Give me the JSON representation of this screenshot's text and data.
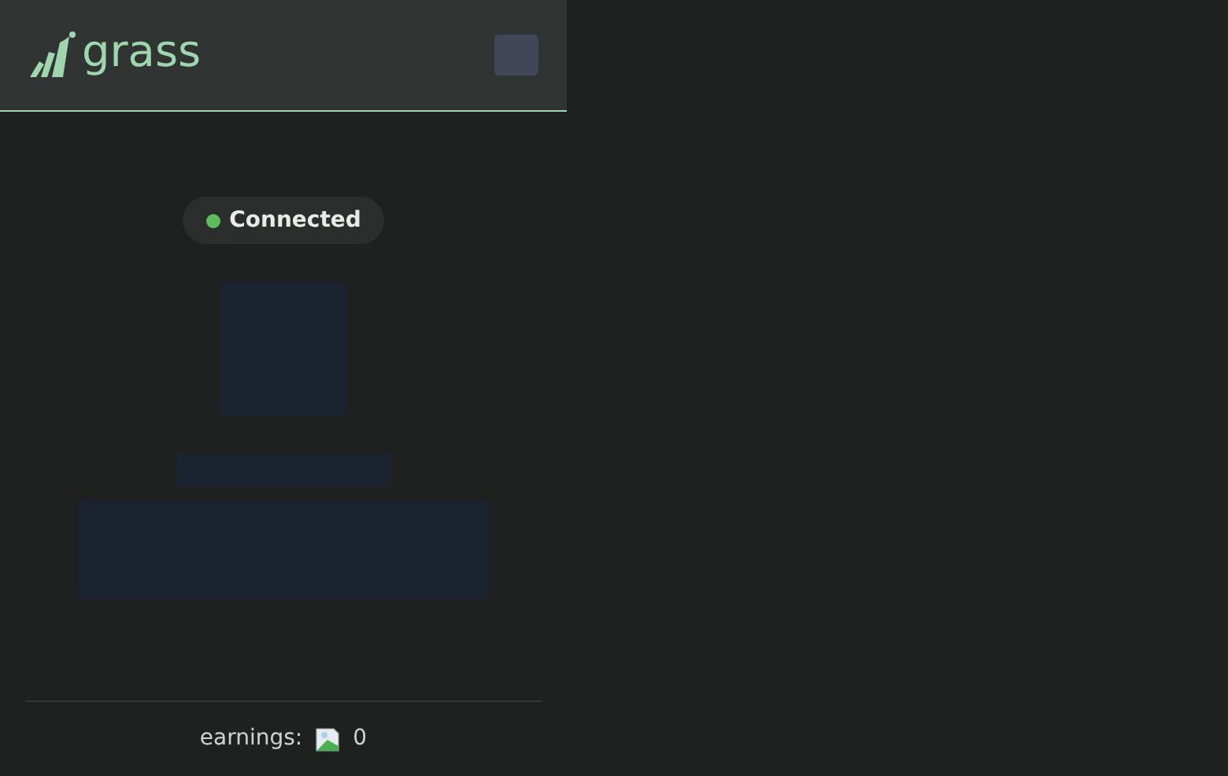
{
  "header": {
    "logo": "grass"
  },
  "status": {
    "label": "Connected",
    "color": "#5cbf5a"
  },
  "footer": {
    "label": "earnings:",
    "value": "0"
  }
}
